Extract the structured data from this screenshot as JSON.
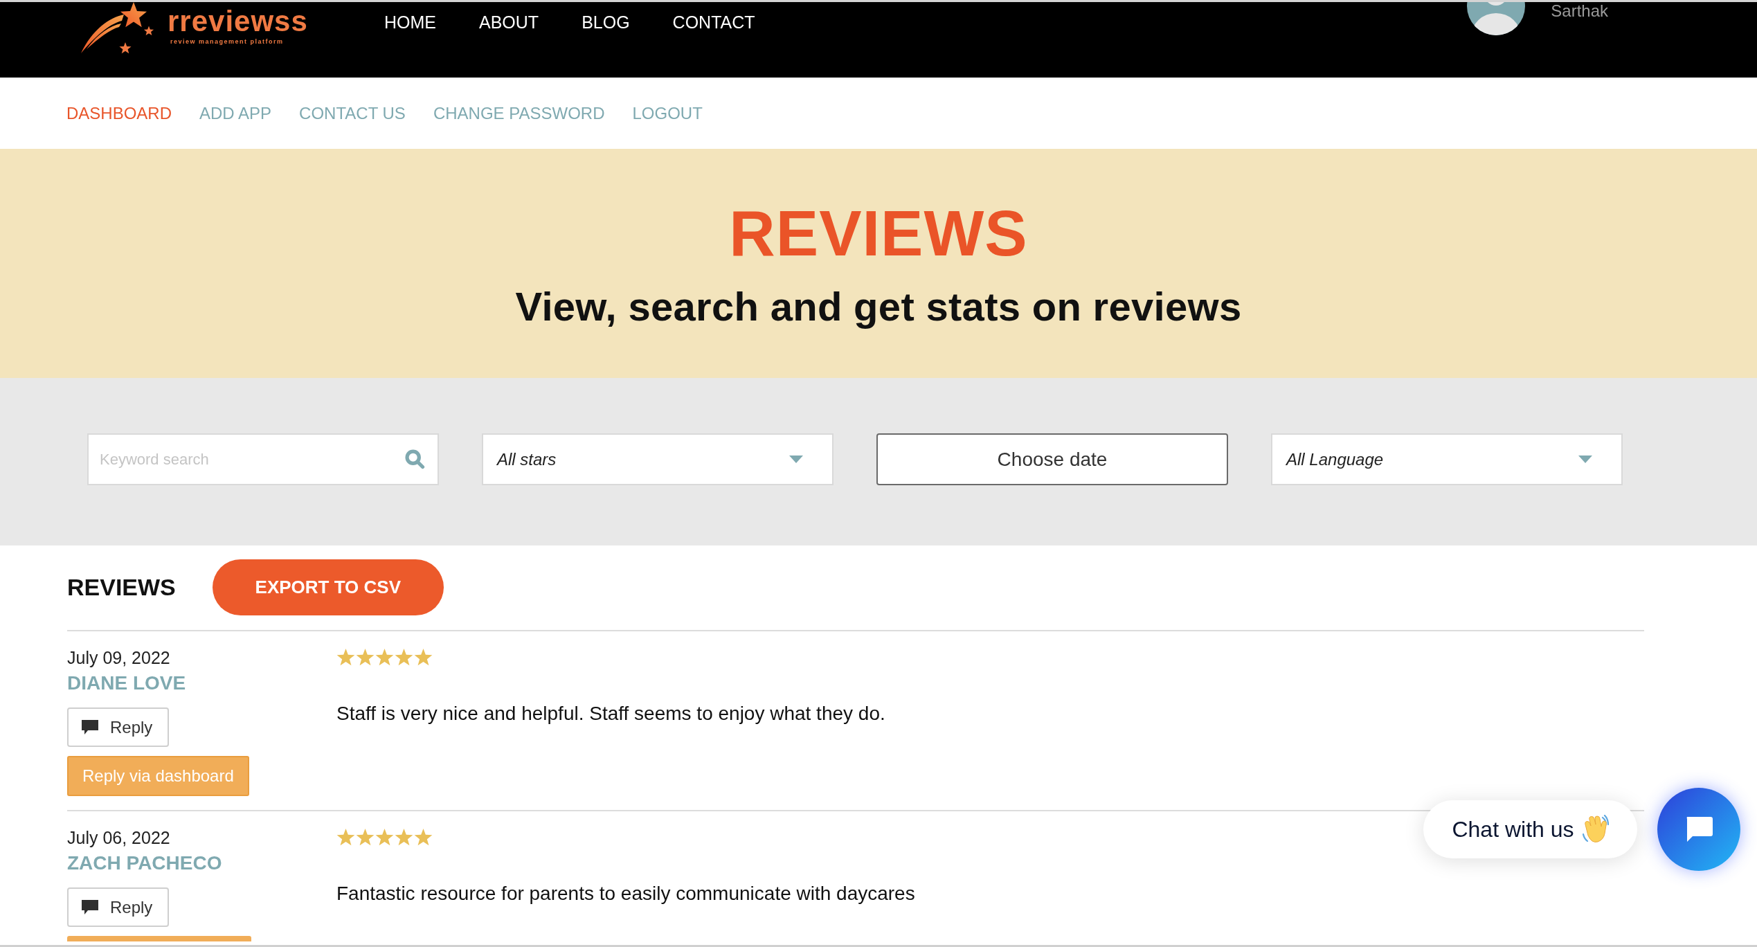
{
  "header": {
    "logo": {
      "name": "rreviewss",
      "tagline": "review management platform"
    },
    "nav": [
      {
        "label": "HOME"
      },
      {
        "label": "ABOUT"
      },
      {
        "label": "BLOG"
      },
      {
        "label": "CONTACT"
      }
    ],
    "user": {
      "name": "Sarthak"
    }
  },
  "subnav": [
    {
      "label": "DASHBOARD",
      "selected": true
    },
    {
      "label": "ADD APP",
      "selected": false
    },
    {
      "label": "CONTACT US",
      "selected": false
    },
    {
      "label": "CHANGE PASSWORD",
      "selected": false
    },
    {
      "label": "LOGOUT",
      "selected": false
    }
  ],
  "hero": {
    "title": "REVIEWS",
    "subtitle": "View, search and get stats on reviews"
  },
  "filters": [
    {
      "kind": "search",
      "placeholder": "Keyword search"
    },
    {
      "kind": "select",
      "value": "All stars"
    },
    {
      "kind": "date",
      "label": "Choose date"
    },
    {
      "kind": "select",
      "value": "All Language"
    }
  ],
  "reviews_section": {
    "heading": "REVIEWS",
    "export_button": "EXPORT TO CSV"
  },
  "reviews": [
    {
      "date": "July 09, 2022",
      "name": "DIANE LOVE",
      "stars": 5,
      "text": "Staff is very nice and helpful. Staff seems to enjoy what they do.",
      "reply_button": "Reply",
      "dashboard_button": {
        "label": "Reply via dashboard",
        "cut": false
      }
    },
    {
      "date": "July 06, 2022",
      "name": "ZACH PACHECO",
      "stars": 5,
      "text": "Fantastic resource for parents to easily communicate with daycares",
      "reply_button": "Reply",
      "dashboard_button": {
        "cut": true
      }
    }
  ],
  "chat": {
    "label": "Chat with us"
  }
}
